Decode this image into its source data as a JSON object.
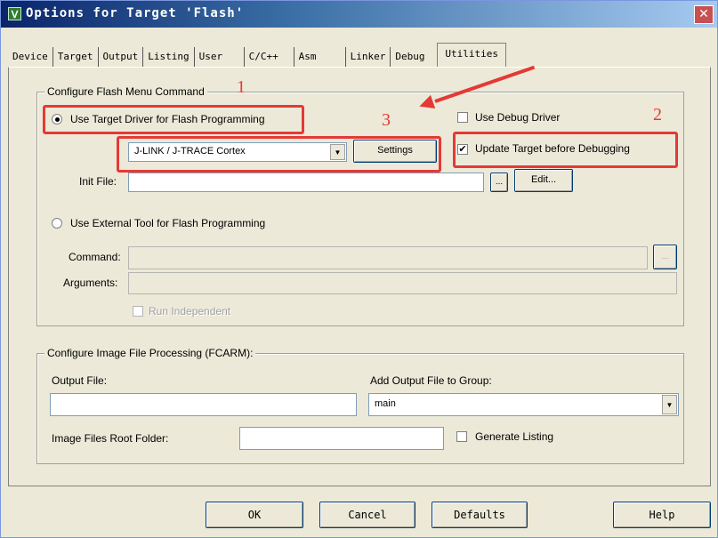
{
  "window": {
    "title": "Options for Target 'Flash'",
    "close": "✕",
    "icon": "Ⅴ"
  },
  "tabs": [
    "Device",
    "Target",
    "Output",
    "Listing",
    "User",
    "C/C++",
    "Asm",
    "Linker",
    "Debug",
    "Utilities"
  ],
  "flash_menu": {
    "group_label": "Configure Flash Menu Command",
    "use_target_driver": "Use Target Driver for Flash Programming",
    "use_target_driver_selected": true,
    "driver_value": "J-LINK / J-TRACE Cortex",
    "settings_button": "Settings",
    "use_debug_driver": "Use Debug Driver",
    "use_debug_driver_checked": false,
    "update_target": "Update Target before Debugging",
    "update_target_checked": true,
    "init_file_label": "Init File:",
    "init_file_value": "",
    "browse_button": "...",
    "edit_button": "Edit...",
    "use_external_tool": "Use External Tool for Flash Programming",
    "command_label": "Command:",
    "arguments_label": "Arguments:",
    "run_independent": "Run Independent"
  },
  "image_processing": {
    "group_label": "Configure Image File Processing (FCARM):",
    "output_file_label": "Output File:",
    "output_file_value": "",
    "add_output_label": "Add Output File  to Group:",
    "group_value": "main",
    "root_folder_label": "Image Files Root Folder:",
    "root_folder_value": "",
    "generate_listing": "Generate Listing",
    "generate_listing_checked": false
  },
  "buttons": {
    "ok": "OK",
    "cancel": "Cancel",
    "defaults": "Defaults",
    "help": "Help"
  },
  "annotations": {
    "n1": "1",
    "n2": "2",
    "n3": "3",
    "color": "#e53935"
  },
  "icons": {
    "check_mark": "✔",
    "dropdown_arrow": "▼"
  }
}
